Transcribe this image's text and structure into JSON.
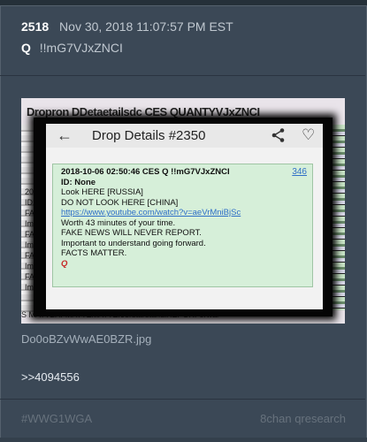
{
  "post": {
    "number": "2518",
    "datetime": "Nov 30, 2018 11:07:57 PM EST",
    "author_letter": "Q",
    "tripcode": "!!mG7VJxZNCI"
  },
  "image": {
    "background_title": "Dropron DDetaetailsdc CES QUANTYVJxZNCI",
    "background_left_text": [
      "2018",
      "ID: N",
      "FA",
      "Im",
      "FA",
      "Im",
      "FA",
      "Im",
      "FA",
      "Im"
    ],
    "background_bottom_text": "S MATTBAFMATTEMATTErJerstarstandiREPORForwar",
    "app_bar_title": "Drop Details #2350",
    "drop": {
      "header": "2018-10-06 02:50:46 CES Q !!mG7VJxZNCI",
      "id_line": "ID: None",
      "number": "346",
      "lines": [
        "Look HERE [RUSSIA]",
        "DO NOT LOOK HERE [CHINA]"
      ],
      "link": "https://www.youtube.com/watch?v=aeVrMniBjSc",
      "lines2": [
        "Worth 43 minutes of your time.",
        "FAKE NEWS WILL NEVER REPORT.",
        "Important to understand going forward.",
        "FACTS MATTER."
      ],
      "signature": "Q"
    }
  },
  "filename": "Do0oBZvWwAE0BZR.jpg",
  "reply": ">>4094556",
  "footer": {
    "hashtag": "#WWG1WGA",
    "source": "8chan qresearch"
  },
  "colors": {
    "page_bg": "#34404c",
    "card_bg": "#3b4856",
    "drop_bg": "#d6efd9",
    "link": "#2f6fc7",
    "signature": "#c62828"
  }
}
